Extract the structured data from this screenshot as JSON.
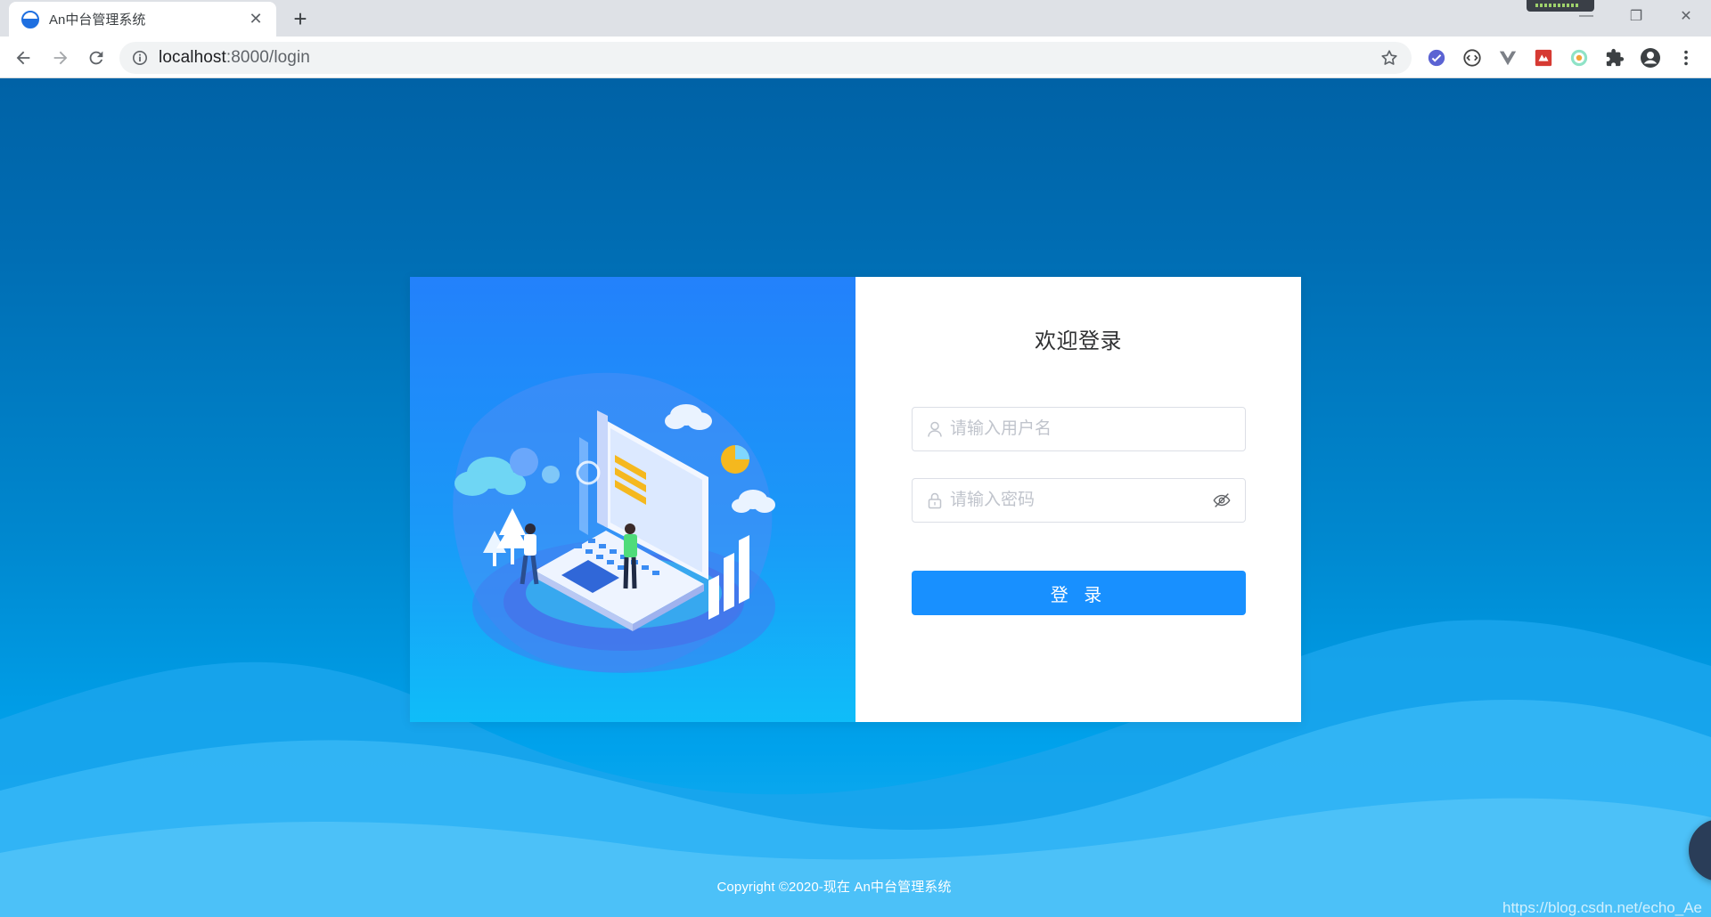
{
  "browser": {
    "tab_title": "An中台管理系统",
    "tab_close": "✕",
    "new_tab": "+",
    "url_host": "localhost",
    "url_path": ":8000/login",
    "window_controls": {
      "minimize": "—",
      "restore": "❐",
      "close": "✕"
    }
  },
  "login": {
    "title": "欢迎登录",
    "username_placeholder": "请输入用户名",
    "password_placeholder": "请输入密码",
    "submit_label": "登 录"
  },
  "footer": {
    "copyright": "Copyright ©2020-现在 An中台管理系统"
  },
  "watermark": "https://blog.csdn.net/echo_Ae",
  "colors": {
    "primary": "#1890ff",
    "page_bg_top": "#0062a6",
    "page_bg_bottom": "#22b3f3",
    "card_left_top": "#2381fb",
    "card_left_bottom": "#0fbdf9"
  },
  "icons": {
    "username": "user-icon",
    "password": "lock-icon",
    "password_toggle": "eye-off-icon"
  }
}
